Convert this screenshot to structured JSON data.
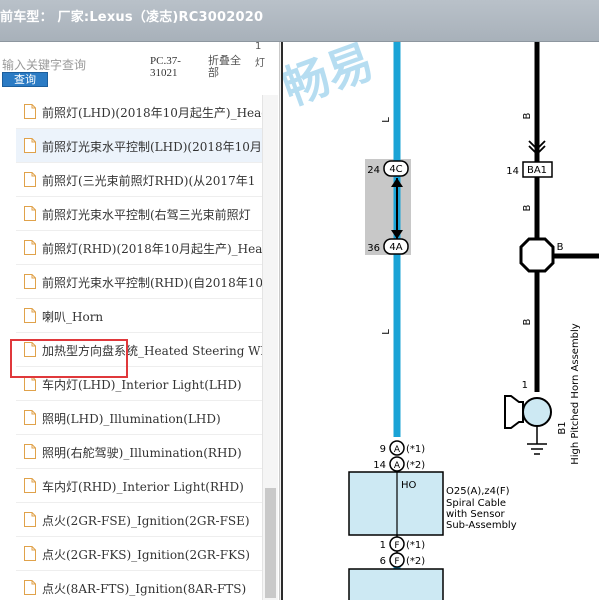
{
  "header": {
    "title": "前车型：  厂家:Lexus（凌志)RC3002020"
  },
  "toolbar": {
    "search_placeholder": "输入关键字查询",
    "query_label": "查询",
    "code_line1": "PC.37-",
    "code_line2": "31021",
    "fold_line1": "折叠全",
    "fold_line2": "部",
    "extra_line1": "1",
    "extra_line2": "灯"
  },
  "docs": [
    {
      "label": "前照灯(LHD)(2018年10月起生产)_Head"
    },
    {
      "label": "前照灯光束水平控制(LHD)(2018年10月"
    },
    {
      "label": "前照灯(三光束前照灯RHD)(从2017年1"
    },
    {
      "label": "前照灯光束水平控制(右驾三光束前照灯"
    },
    {
      "label": "前照灯(RHD)(2018年10月起生产)_Head"
    },
    {
      "label": "前照灯光束水平控制(RHD)(自2018年10"
    },
    {
      "label": "喇叭_Horn"
    },
    {
      "label": "加热型方向盘系统_Heated Steering Wh"
    },
    {
      "label": "车内灯(LHD)_Interior Light(LHD)"
    },
    {
      "label": "照明(LHD)_Illumination(LHD)"
    },
    {
      "label": "照明(右舵驾驶)_Illumination(RHD)"
    },
    {
      "label": "车内灯(RHD)_Interior Light(RHD)"
    },
    {
      "label": "点火(2GR-FSE)_Ignition(2GR-FSE)"
    },
    {
      "label": "点火(2GR-FKS)_Ignition(2GR-FKS)"
    },
    {
      "label": "点火(8AR-FTS)_Ignition(8AR-FTS)"
    }
  ],
  "diagram": {
    "watermark": "畅易",
    "wire_l1": "L",
    "wire_l2": "L",
    "wire_b1": "B",
    "wire_b2": "B",
    "wire_b3": "B",
    "wire_b4": "B",
    "pin_24": "24",
    "conn_4c": "4C",
    "pin_36": "36",
    "conn_4a": "4A",
    "pin_14": "14",
    "conn_ba1": "BA1",
    "pin_1": "1",
    "b1_code": "B1",
    "horn_label": "High Pitched Horn Assembly",
    "pin_9": "9",
    "conn_a1": "A",
    "note_1": "(*1)",
    "pin_14b": "14",
    "conn_a2": "A",
    "note_2": "(*2)",
    "box_ho": "HO",
    "spiral_codes": "O25(A),z4(F)",
    "spiral_l1": "Spiral Cable",
    "spiral_l2": "with Sensor",
    "spiral_l3": "Sub-Assembly",
    "pin_1b": "1",
    "conn_f1": "F",
    "note_3": "(*1)",
    "pin_6": "6",
    "conn_f2": "F",
    "note_4": "(*2)"
  },
  "colors": {
    "wire_blue": "#1aa3d6",
    "highlight": "#e0383b",
    "box_fill": "#cde9f3"
  }
}
